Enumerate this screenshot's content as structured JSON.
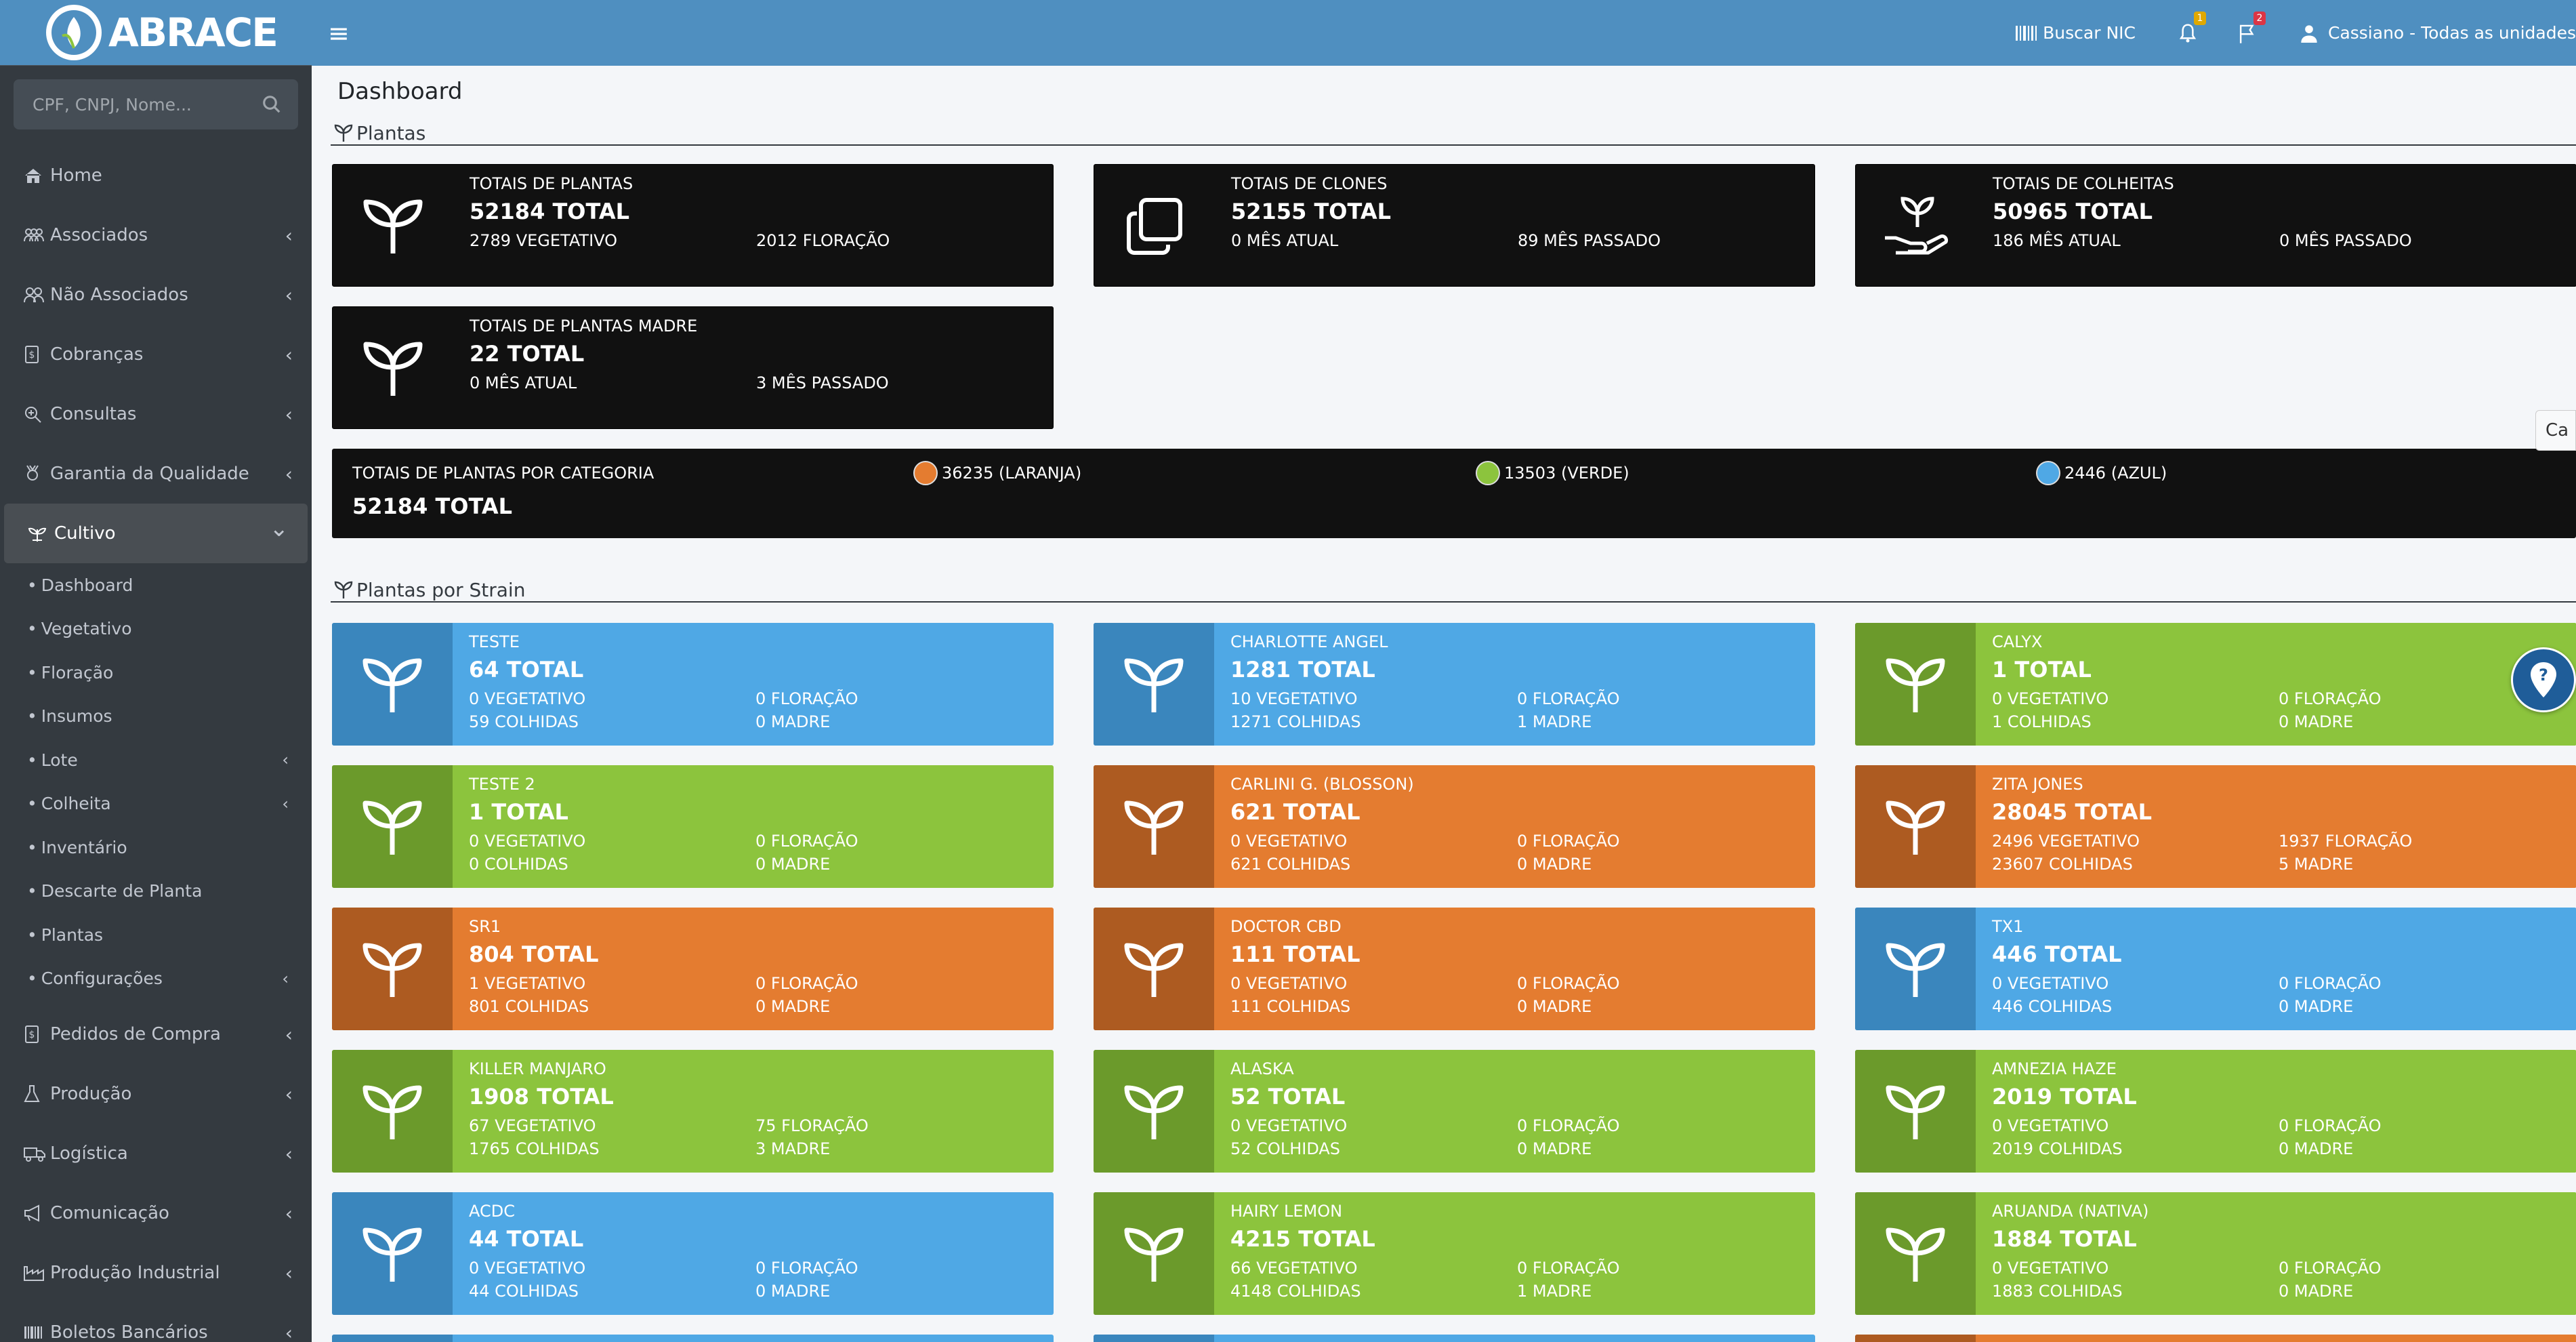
{
  "brand": {
    "name": "ABRACE"
  },
  "search": {
    "placeholder": "CPF, CNPJ, Nome..."
  },
  "nav": [
    {
      "label": "Home",
      "icon": "home-icon"
    },
    {
      "label": "Associados",
      "icon": "users-icon"
    },
    {
      "label": "Não Associados",
      "icon": "user-group-icon"
    },
    {
      "label": "Cobranças",
      "icon": "invoice-icon"
    },
    {
      "label": "Consultas",
      "icon": "search-plus-icon"
    },
    {
      "label": "Garantia da Qualidade",
      "icon": "award-icon"
    },
    {
      "label": "Cultivo",
      "icon": "plant-icon"
    }
  ],
  "subnav": [
    {
      "label": "Dashboard",
      "chev": ""
    },
    {
      "label": "Vegetativo",
      "chev": ""
    },
    {
      "label": "Floração",
      "chev": ""
    },
    {
      "label": "Insumos",
      "chev": ""
    },
    {
      "label": "Lote",
      "chev": "‹"
    },
    {
      "label": "Colheita",
      "chev": "‹"
    },
    {
      "label": "Inventário",
      "chev": ""
    },
    {
      "label": "Descarte de Planta",
      "chev": ""
    },
    {
      "label": "Plantas",
      "chev": ""
    },
    {
      "label": "Configurações",
      "chev": "‹"
    }
  ],
  "nav2": [
    {
      "label": "Pedidos de Compra",
      "icon": "invoice-icon"
    },
    {
      "label": "Produção",
      "icon": "flask-icon"
    },
    {
      "label": "Logística",
      "icon": "truck-icon"
    },
    {
      "label": "Comunicação",
      "icon": "megaphone-icon"
    },
    {
      "label": "Produção Industrial",
      "icon": "factory-icon"
    },
    {
      "label": "Boletos Bancários",
      "icon": "barcode-icon"
    }
  ],
  "topbar": {
    "buscar": "Buscar NIC",
    "notif_count": "1",
    "flag_count": "2",
    "user": "Cassiano - Todas as unidades"
  },
  "page": {
    "title": "Dashboard",
    "section1": "Plantas",
    "section2": "Plantas por Strain"
  },
  "summary": [
    {
      "title": "TOTAIS DE PLANTAS",
      "total": "52184 TOTAL",
      "a": "2789 VEGETATIVO",
      "b": "2012 FLORAÇÃO",
      "icon": "sprout-icon"
    },
    {
      "title": "TOTAIS DE CLONES",
      "total": "52155 TOTAL",
      "a": "0 MÊS ATUAL",
      "b": "89 MÊS PASSADO",
      "icon": "clone-icon"
    },
    {
      "title": "TOTAIS DE COLHEITAS",
      "total": "50965 TOTAL",
      "a": "186 MÊS ATUAL",
      "b": "0 MÊS PASSADO",
      "icon": "harvest-icon"
    },
    {
      "title": "TOTAIS DE PLANTAS MADRE",
      "total": "22 TOTAL",
      "a": "0 MÊS ATUAL",
      "b": "3 MÊS PASSADO",
      "icon": "sprout-icon"
    }
  ],
  "categoria": {
    "title": "TOTAIS DE PLANTAS POR CATEGORIA",
    "total": "52184 TOTAL",
    "items": [
      {
        "label": "36235 (LARANJA)",
        "color": "#e47c30"
      },
      {
        "label": "13503 (VERDE)",
        "color": "#8cc43d"
      },
      {
        "label": "2446 (AZUL)",
        "color": "#4fa8e5"
      }
    ]
  },
  "strains": [
    {
      "name": "TESTE",
      "total": "64 TOTAL",
      "veg": "0 VEGETATIVO",
      "flor": "0 FLORAÇÃO",
      "col": "59 COLHIDAS",
      "madre": "0 MADRE",
      "color": "blue"
    },
    {
      "name": "CHARLOTTE ANGEL",
      "total": "1281 TOTAL",
      "veg": "10 VEGETATIVO",
      "flor": "0 FLORAÇÃO",
      "col": "1271 COLHIDAS",
      "madre": "1 MADRE",
      "color": "blue"
    },
    {
      "name": "CALYX",
      "total": "1 TOTAL",
      "veg": "0 VEGETATIVO",
      "flor": "0 FLORAÇÃO",
      "col": "1 COLHIDAS",
      "madre": "0 MADRE",
      "color": "green"
    },
    {
      "name": "TESTE 2",
      "total": "1 TOTAL",
      "veg": "0 VEGETATIVO",
      "flor": "0 FLORAÇÃO",
      "col": "0 COLHIDAS",
      "madre": "0 MADRE",
      "color": "green"
    },
    {
      "name": "CARLINI G. (BLOSSON)",
      "total": "621 TOTAL",
      "veg": "0 VEGETATIVO",
      "flor": "0 FLORAÇÃO",
      "col": "621 COLHIDAS",
      "madre": "0 MADRE",
      "color": "orange"
    },
    {
      "name": "ZITA JONES",
      "total": "28045 TOTAL",
      "veg": "2496 VEGETATIVO",
      "flor": "1937 FLORAÇÃO",
      "col": "23607 COLHIDAS",
      "madre": "5 MADRE",
      "color": "orange"
    },
    {
      "name": "SR1",
      "total": "804 TOTAL",
      "veg": "1 VEGETATIVO",
      "flor": "0 FLORAÇÃO",
      "col": "801 COLHIDAS",
      "madre": "0 MADRE",
      "color": "orange"
    },
    {
      "name": "DOCTOR CBD",
      "total": "111 TOTAL",
      "veg": "0 VEGETATIVO",
      "flor": "0 FLORAÇÃO",
      "col": "111 COLHIDAS",
      "madre": "0 MADRE",
      "color": "orange"
    },
    {
      "name": "TX1",
      "total": "446 TOTAL",
      "veg": "0 VEGETATIVO",
      "flor": "0 FLORAÇÃO",
      "col": "446 COLHIDAS",
      "madre": "0 MADRE",
      "color": "blue"
    },
    {
      "name": "KILLER MANJARO",
      "total": "1908 TOTAL",
      "veg": "67 VEGETATIVO",
      "flor": "75 FLORAÇÃO",
      "col": "1765 COLHIDAS",
      "madre": "3 MADRE",
      "color": "green"
    },
    {
      "name": "ALASKA",
      "total": "52 TOTAL",
      "veg": "0 VEGETATIVO",
      "flor": "0 FLORAÇÃO",
      "col": "52 COLHIDAS",
      "madre": "0 MADRE",
      "color": "green"
    },
    {
      "name": "AMNEZIA HAZE",
      "total": "2019 TOTAL",
      "veg": "0 VEGETATIVO",
      "flor": "0 FLORAÇÃO",
      "col": "2019 COLHIDAS",
      "madre": "0 MADRE",
      "color": "green"
    },
    {
      "name": "ACDC",
      "total": "44 TOTAL",
      "veg": "0 VEGETATIVO",
      "flor": "0 FLORAÇÃO",
      "col": "44 COLHIDAS",
      "madre": "0 MADRE",
      "color": "blue"
    },
    {
      "name": "HAIRY LEMON",
      "total": "4215 TOTAL",
      "veg": "66 VEGETATIVO",
      "flor": "0 FLORAÇÃO",
      "col": "4148 COLHIDAS",
      "madre": "1 MADRE",
      "color": "green"
    },
    {
      "name": "ARUANDA (NATIVA)",
      "total": "1884 TOTAL",
      "veg": "0 VEGETATIVO",
      "flor": "0 FLORAÇÃO",
      "col": "1883 COLHIDAS",
      "madre": "0 MADRE",
      "color": "green"
    }
  ],
  "edge_tab": "Ca"
}
